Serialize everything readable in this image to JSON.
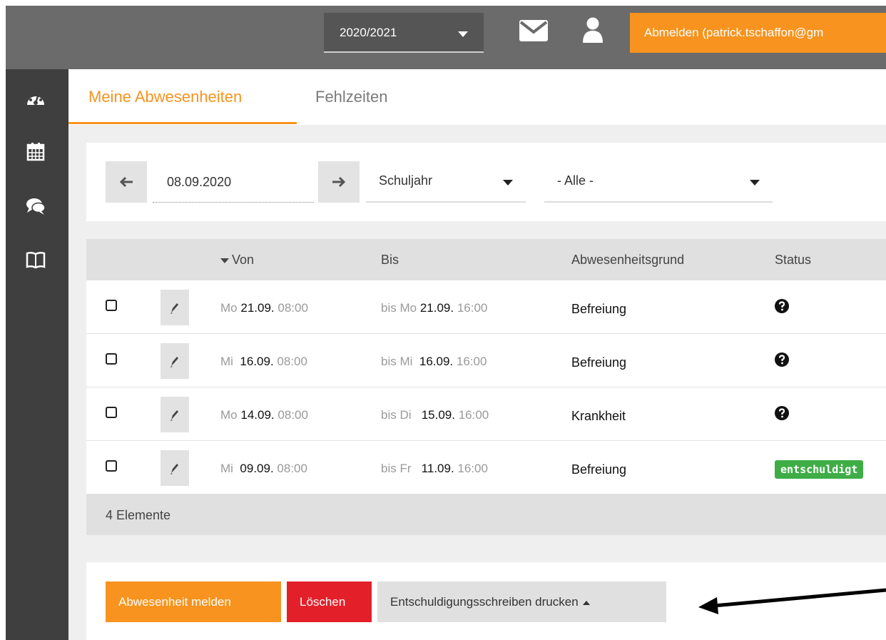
{
  "header": {
    "year_select": "2020/2021",
    "logout_label": "Abmelden (patrick.tschaffon@gm"
  },
  "sidebar": {
    "icons": [
      "dashboard-icon",
      "calendar-icon",
      "comments-icon",
      "book-icon"
    ]
  },
  "tabs": [
    {
      "label": "Meine Abwesenheiten",
      "active": true
    },
    {
      "label": "Fehlzeiten",
      "active": false
    }
  ],
  "filters": {
    "date": "08.09.2020",
    "period": "Schuljahr",
    "category": "- Alle -"
  },
  "table": {
    "columns": [
      "Von",
      "Bis",
      "Abwesenheitsgrund",
      "Status"
    ],
    "rows": [
      {
        "von_day": "Mo",
        "von_date": "21.09.",
        "von_time": "08:00",
        "bis_prefix": "bis Mo",
        "bis_date": "21.09.",
        "bis_time": "16:00",
        "reason": "Befreiung",
        "status": "unknown"
      },
      {
        "von_day": "Mi",
        "von_date": "16.09.",
        "von_time": "08:00",
        "bis_prefix": "bis Mi",
        "bis_date": "16.09.",
        "bis_time": "16:00",
        "reason": "Befreiung",
        "status": "unknown"
      },
      {
        "von_day": "Mo",
        "von_date": "14.09.",
        "von_time": "08:00",
        "bis_prefix": "bis Di",
        "bis_date": "15.09.",
        "bis_time": "16:00",
        "reason": "Krankheit",
        "status": "unknown"
      },
      {
        "von_day": "Mi",
        "von_date": "09.09.",
        "von_time": "08:00",
        "bis_prefix": "bis Fr",
        "bis_date": "11.09.",
        "bis_time": "16:00",
        "reason": "Befreiung",
        "status": "entschuldigt"
      }
    ],
    "footer": "4 Elemente"
  },
  "actions": {
    "report_label": "Abwesenheit melden",
    "delete_label": "Löschen",
    "print_label": "Entschuldigungsschreiben drucken"
  },
  "colors": {
    "accent": "#f7931e",
    "danger": "#e3202a",
    "success": "#3fad46",
    "topbar": "#6b6b6b",
    "sidebar": "#3f3f3f"
  }
}
